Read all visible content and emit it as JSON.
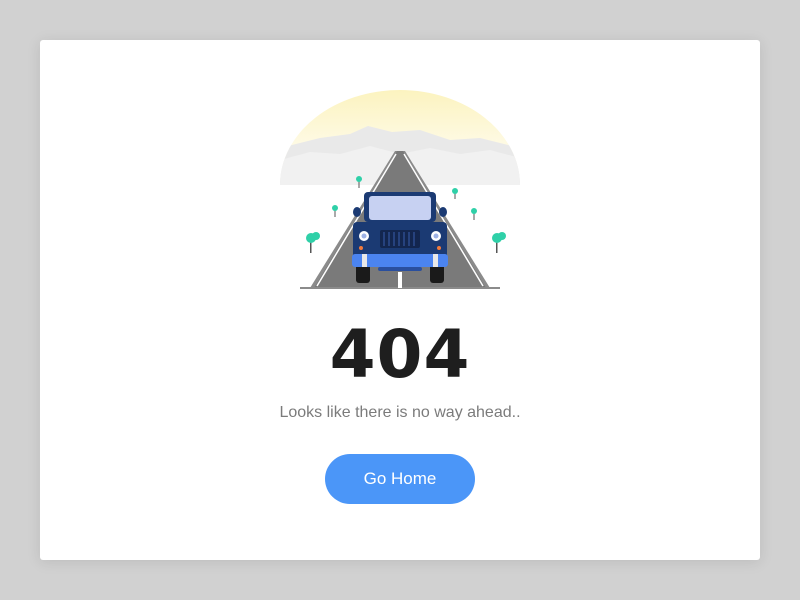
{
  "error": {
    "code": "404",
    "message": "Looks like there is no way ahead..",
    "button_label": "Go Home"
  },
  "illustration": {
    "subject": "jeep-on-road",
    "colors": {
      "sun": "#fcf4c4",
      "mountains": "#ebebeb",
      "road": "#8a8a8a",
      "jeep_body": "#1b3a73",
      "jeep_bumper": "#4b84f0",
      "trees": "#2fd0a8"
    }
  },
  "colors": {
    "page_background": "#d1d1d1",
    "card_background": "#ffffff",
    "button": "#4b96f8",
    "code_text": "#1e1e1e",
    "message_text": "#7b7b7b"
  }
}
